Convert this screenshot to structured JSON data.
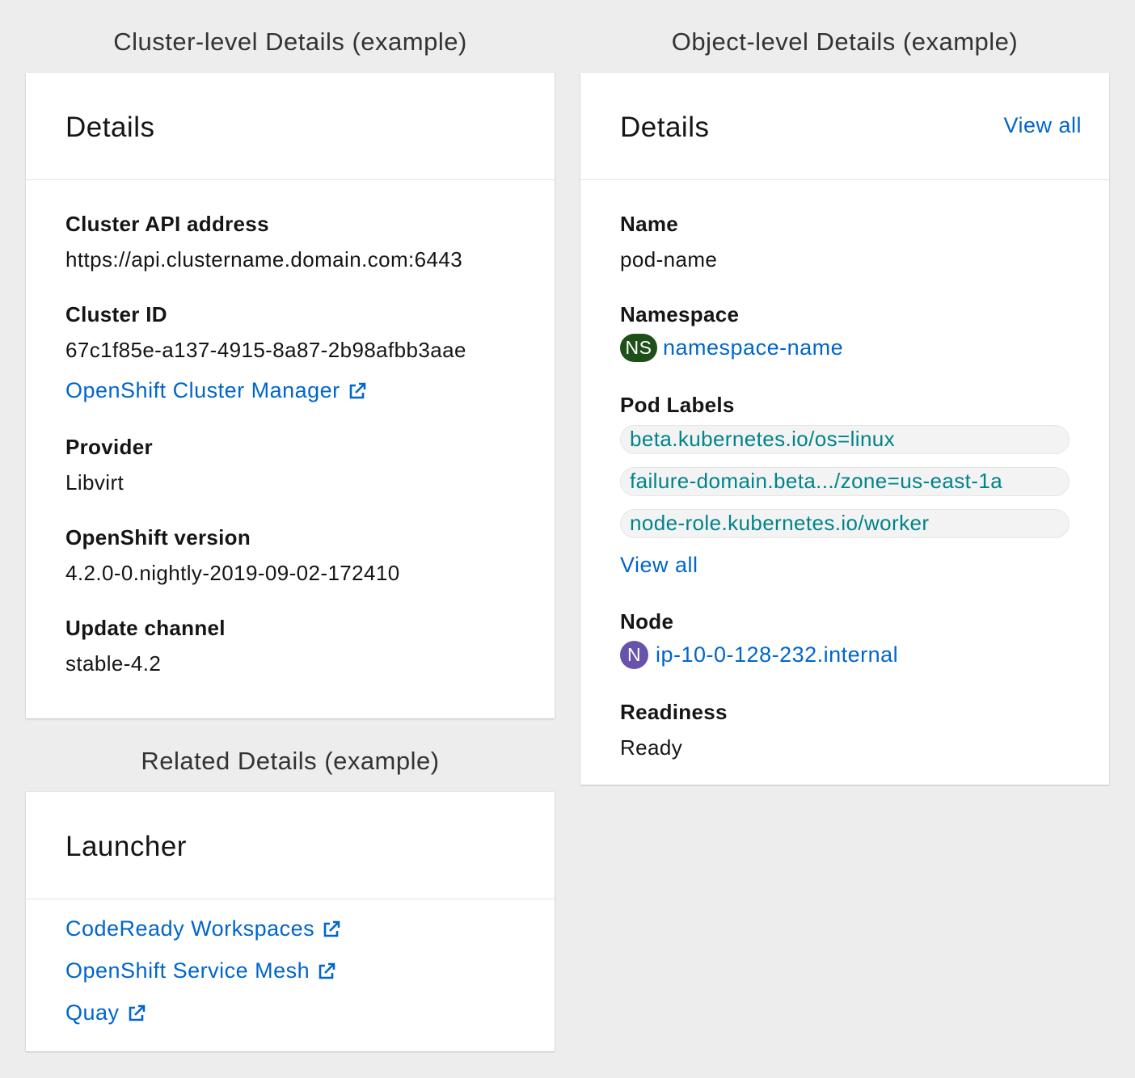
{
  "captions": {
    "cluster": "Cluster-level Details (example)",
    "object": "Object-level Details (example)",
    "related": "Related Details (example)"
  },
  "cluster_card": {
    "title": "Details",
    "api_label": "Cluster API address",
    "api_value": "https://api.clustername.domain.com:6443",
    "id_label": "Cluster ID",
    "id_value": "67c1f85e-a137-4915-8a87-2b98afbb3aae",
    "ocm_link": "OpenShift Cluster Manager",
    "provider_label": "Provider",
    "provider_value": "Libvirt",
    "version_label": "OpenShift version",
    "version_value": "4.2.0-0.nightly-2019-09-02-172410",
    "channel_label": "Update channel",
    "channel_value": "stable-4.2"
  },
  "object_card": {
    "title": "Details",
    "view_all": "View all",
    "name_label": "Name",
    "name_value": "pod-name",
    "namespace_label": "Namespace",
    "namespace_badge": "NS",
    "namespace_link": "namespace-name",
    "labels_label": "Pod Labels",
    "labels": [
      "beta.kubernetes.io/os=linux",
      "failure-domain.beta.../zone=us-east-1a",
      "node-role.kubernetes.io/worker"
    ],
    "labels_view_all": "View all",
    "node_label": "Node",
    "node_badge": "N",
    "node_link": "ip-10-0-128-232.internal",
    "readiness_label": "Readiness",
    "readiness_value": "Ready"
  },
  "launcher_card": {
    "title": "Launcher",
    "links": [
      "CodeReady Workspaces",
      "OpenShift Service Mesh",
      "Quay"
    ]
  },
  "colors": {
    "link": "#0066cc",
    "label_text": "#00838a",
    "ns_badge": "#1e4f18",
    "node_badge": "#6753ac",
    "background": "#ededed"
  },
  "icons": {
    "external_link": "external-link-icon"
  }
}
